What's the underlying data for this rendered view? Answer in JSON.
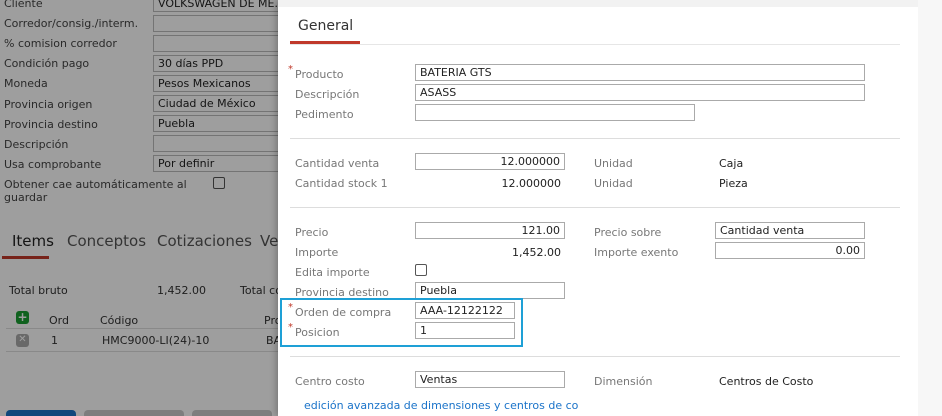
{
  "background_form": {
    "fields": [
      {
        "label": "Cliente",
        "value": "VOLKSWAGEN DE ME..."
      },
      {
        "label": "Corredor/consig./interm.",
        "value": ""
      },
      {
        "label": "% comision corredor",
        "value": ""
      },
      {
        "label": "Condición pago",
        "value": "30 días PPD"
      },
      {
        "label": "Moneda",
        "value": "Pesos Mexicanos"
      },
      {
        "label": "Provincia origen",
        "value": "Ciudad de México"
      },
      {
        "label": "Provincia destino",
        "value": "Puebla"
      },
      {
        "label": "Descripción",
        "value": ""
      },
      {
        "label": "Usa comprobante",
        "value": "Por definir"
      }
    ],
    "cae_label_line1": "Obtener cae automáticamente al",
    "cae_label_line2": "guardar",
    "tabs": [
      "Items",
      "Conceptos",
      "Cotizaciones",
      "Ve"
    ],
    "active_tab": "Items",
    "totals": {
      "bruto_label": "Total bruto",
      "bruto_value": "1,452.00",
      "other_label": "Total co"
    },
    "table": {
      "headers": [
        "Ord",
        "Código",
        "Pro"
      ],
      "rows": [
        {
          "ord": "1",
          "codigo": "HMC9000-LI(24)-10",
          "producto": "BA"
        }
      ]
    }
  },
  "panel": {
    "tab_label": "General",
    "producto": {
      "label": "Producto",
      "value": "BATERIA GTS"
    },
    "descripcion": {
      "label": "Descripción",
      "value": "ASASS"
    },
    "pedimento": {
      "label": "Pedimento",
      "value": ""
    },
    "cantidad_venta": {
      "label": "Cantidad venta",
      "value": "12.000000",
      "unit_label": "Unidad",
      "unit_value": "Caja"
    },
    "cantidad_stock": {
      "label": "Cantidad stock 1",
      "value": "12.000000",
      "unit_label": "Unidad",
      "unit_value": "Pieza"
    },
    "precio": {
      "label": "Precio",
      "value": "121.00"
    },
    "precio_sobre": {
      "label": "Precio sobre",
      "value": "Cantidad venta"
    },
    "importe": {
      "label": "Importe",
      "value": "1,452.00"
    },
    "importe_exento": {
      "label": "Importe exento",
      "value": "0.00"
    },
    "edita_importe": {
      "label": "Edita importe"
    },
    "provincia_destino": {
      "label": "Provincia destino",
      "value": "Puebla"
    },
    "orden_compra": {
      "label": "Orden de compra",
      "value": "AAA-12122122"
    },
    "posicion": {
      "label": "Posicion",
      "value": "1"
    },
    "centro_costo": {
      "label": "Centro costo",
      "value": "Ventas"
    },
    "dimension": {
      "label": "Dimensión",
      "value": "Centros de Costo"
    },
    "link_text": "edición avanzada de dimensiones y centros de co",
    "required_mark": "*"
  },
  "colors": {
    "accent_red": "#c0392b",
    "highlight_blue": "#1ea0d6",
    "link_blue": "#1a73c9",
    "add_green": "#1a9e33"
  },
  "icons": {
    "add": "plus-icon",
    "delete": "close-icon"
  }
}
